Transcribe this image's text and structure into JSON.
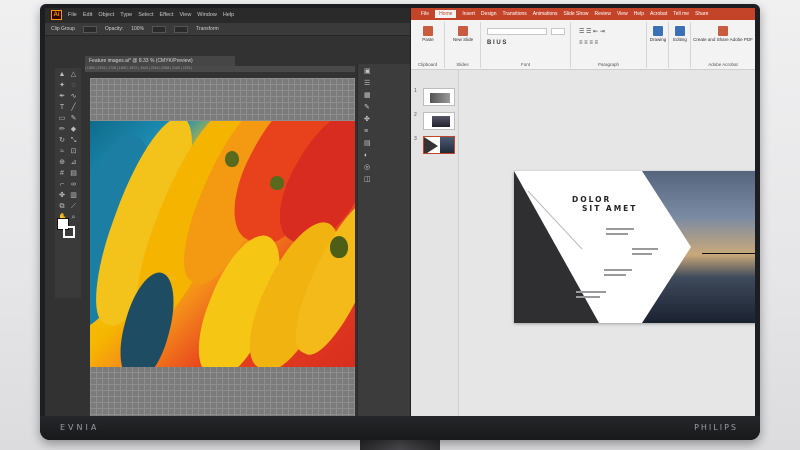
{
  "monitor": {
    "brand_left": "EVNIA",
    "brand_right": "PHILIPS"
  },
  "illustrator": {
    "logo": "Ai",
    "menu": [
      "File",
      "Edit",
      "Object",
      "Type",
      "Select",
      "Effect",
      "View",
      "Window",
      "Help"
    ],
    "control_bar": {
      "selection": "Clip Group",
      "opacity_label": "Opacity:",
      "opacity_value": "100%",
      "transform_label": "Transform"
    },
    "document_tab": "Feature images.ai* @ 8.33 % (CMYK/Preview)",
    "ruler_ticks": "| 1584 | 1576 | 1728 | 1800 | 1872 | 1944 | 2016 | 2088 | 2160 | 2232 |",
    "tool_icons": [
      "selection-arrow-icon",
      "direct-select-icon",
      "magic-wand-icon",
      "lasso-icon",
      "pen-icon",
      "curvature-icon",
      "type-icon",
      "line-icon",
      "rectangle-icon",
      "brush-icon",
      "pencil-icon",
      "eraser-icon",
      "rotate-icon",
      "scale-icon",
      "warp-icon",
      "free-transform-icon",
      "shape-builder-icon",
      "perspective-icon",
      "mesh-icon",
      "gradient-icon",
      "eyedropper-icon",
      "blend-icon",
      "symbol-icon",
      "graph-icon",
      "artboard-icon",
      "slice-icon",
      "hand-icon",
      "zoom-icon"
    ]
  },
  "powerpoint": {
    "tabs": [
      "File",
      "Home",
      "Insert",
      "Design",
      "Transitions",
      "Animations",
      "Slide Show",
      "Review",
      "View",
      "Help",
      "Acrobat",
      "Tell me",
      "Share"
    ],
    "active_tab": "Home",
    "ribbon_groups": [
      {
        "label": "Clipboard",
        "button": "Paste"
      },
      {
        "label": "Slides",
        "button": "New Slide"
      },
      {
        "label": "Font",
        "button": ""
      },
      {
        "label": "Paragraph",
        "button": ""
      },
      {
        "label": "",
        "button": "Drawing"
      },
      {
        "label": "",
        "button": "Editing"
      },
      {
        "label": "Adobe Acrobat",
        "button": "Create and Share Adobe PDF"
      }
    ],
    "thumbnails": [
      "1",
      "2",
      "3"
    ],
    "selected_thumbnail": 3,
    "slide": {
      "title_line1": "DOLOR",
      "title_line2": "SIT AMET"
    }
  }
}
